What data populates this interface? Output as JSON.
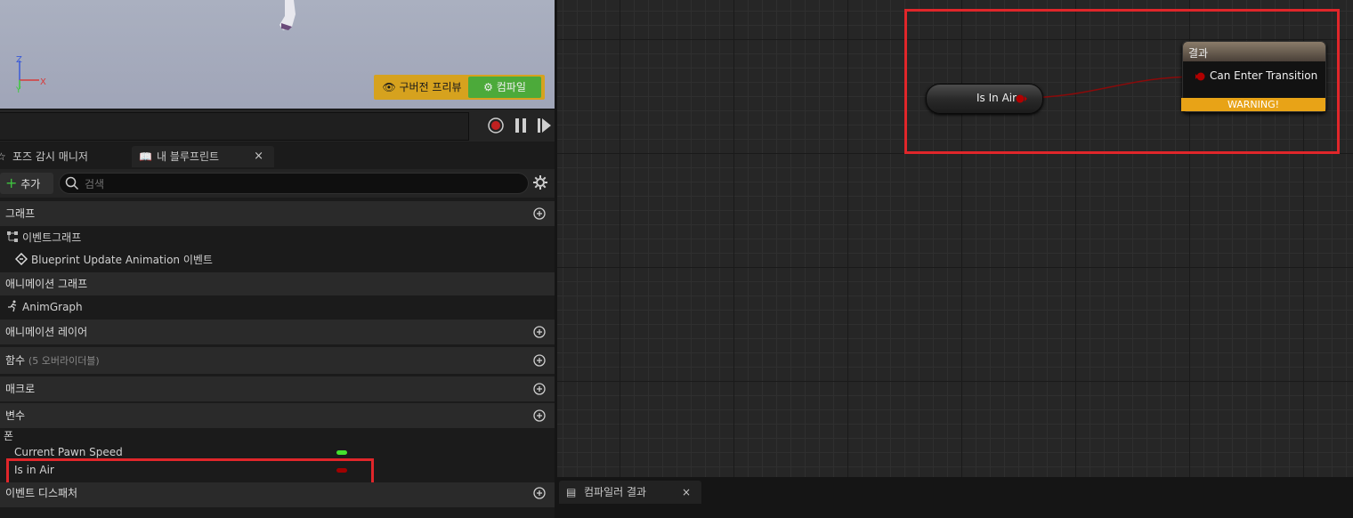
{
  "viewport": {
    "preview_label": "구버전 프리뷰",
    "compile_label": "컴파일",
    "axis": {
      "z": "Z",
      "y": "Y",
      "x": "X"
    }
  },
  "tabs": {
    "pose_watch": "포즈 감시 매니저",
    "my_blueprint": "내 블루프린트",
    "close": "×"
  },
  "toolbar": {
    "add_label": "추가",
    "search_placeholder": "검색"
  },
  "sections": {
    "graphs": "그래프",
    "event_graph": "이벤트그래프",
    "bp_update_event": "Blueprint Update Animation 이벤트",
    "anim_graphs": "애니메이션 그래프",
    "anim_graph": "AnimGraph",
    "anim_layers": "애니메이션 레이어",
    "functions": "함수",
    "functions_sub": "(5 오버라이더블)",
    "macros": "매크로",
    "variables": "변수",
    "var_group": "폰",
    "var_speed": "Current Pawn Speed",
    "var_in_air": "Is in Air",
    "event_dispatchers": "이벤트 디스패처"
  },
  "graph": {
    "var_node_label": "Is In Air",
    "result_title": "결과",
    "result_pin": "Can Enter Transition",
    "warning": "WARNING!"
  },
  "bottom": {
    "compiler_results": "컴파일러 결과",
    "close": "×"
  },
  "colors": {
    "float_pin": "#44e02e",
    "bool_pin": "#a00000",
    "warning": "#e8a317",
    "highlight": "#e0262a"
  }
}
